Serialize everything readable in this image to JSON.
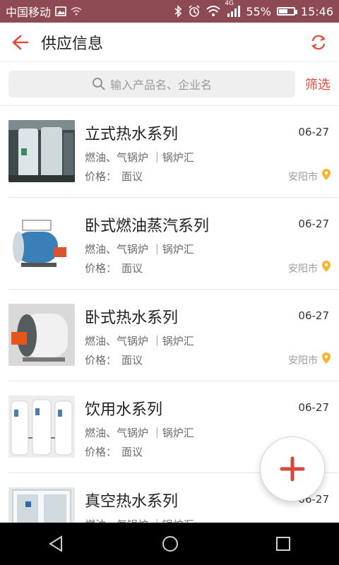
{
  "status": {
    "carrier": "中国移动",
    "signal_label": "4G",
    "battery": "55%",
    "time": "15:46"
  },
  "header": {
    "title": "供应信息"
  },
  "search": {
    "placeholder": "输入产品名、企业名",
    "filter_label": "筛选"
  },
  "items": [
    {
      "title": "立式热水系列",
      "date": "06-27",
      "meta": "燃油、气锅炉 ｜锅炉汇",
      "price_label": "价格：",
      "price_value": "面议",
      "city": "安阳市"
    },
    {
      "title": "卧式燃油蒸汽系列",
      "date": "06-27",
      "meta": "燃油、气锅炉 ｜锅炉汇",
      "price_label": "价格：",
      "price_value": "面议",
      "city": "安阳市"
    },
    {
      "title": "卧式热水系列",
      "date": "06-27",
      "meta": "燃油、气锅炉 ｜锅炉汇",
      "price_label": "价格：",
      "price_value": "面议",
      "city": "安阳市"
    },
    {
      "title": "饮用水系列",
      "date": "06-27",
      "meta": "燃油、气锅炉 ｜锅炉汇",
      "price_label": "价格：",
      "price_value": "面议",
      "city": ""
    },
    {
      "title": "真空热水系列",
      "date": "06-27",
      "meta": "燃油、气锅炉 ｜锅炉汇",
      "price_label": "",
      "price_value": "",
      "city": ""
    }
  ],
  "colors": {
    "status_bar": "#8e4a52",
    "accent": "#e24a3b",
    "pin": "#f5b52e"
  }
}
